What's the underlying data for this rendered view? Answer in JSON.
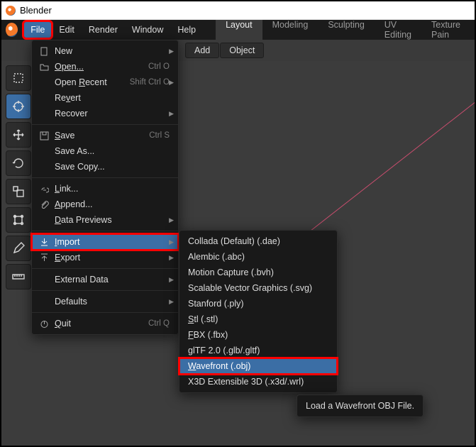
{
  "window": {
    "title": "Blender"
  },
  "top_menu": {
    "items": [
      "File",
      "Edit",
      "Render",
      "Window",
      "Help"
    ],
    "active": "File"
  },
  "workspace_tabs": [
    "Layout",
    "Modeling",
    "Sculpting",
    "UV Editing",
    "Texture Pain"
  ],
  "toolbar": {
    "add": "Add",
    "object": "Object"
  },
  "file_menu": {
    "new": "New",
    "open": "Open...",
    "open_shortcut": "Ctrl O",
    "open_recent": "Open Recent",
    "open_recent_shortcut": "Shift Ctrl O",
    "revert": "Revert",
    "recover": "Recover",
    "save": "Save",
    "save_shortcut": "Ctrl S",
    "save_as": "Save As...",
    "save_copy": "Save Copy...",
    "link": "Link...",
    "append": "Append...",
    "data_previews": "Data Previews",
    "import": "Import",
    "export": "Export",
    "external_data": "External Data",
    "defaults": "Defaults",
    "quit": "Quit",
    "quit_shortcut": "Ctrl Q"
  },
  "import_submenu": {
    "items": [
      "Collada (Default) (.dae)",
      "Alembic (.abc)",
      "Motion Capture (.bvh)",
      "Scalable Vector Graphics (.svg)",
      "Stanford (.ply)",
      "Stl (.stl)",
      "FBX (.fbx)",
      "glTF 2.0 (.glb/.gltf)",
      "Wavefront (.obj)",
      "X3D Extensible 3D (.x3d/.wrl)"
    ],
    "highlighted": "Wavefront (.obj)"
  },
  "tooltip": "Load a Wavefront OBJ File."
}
